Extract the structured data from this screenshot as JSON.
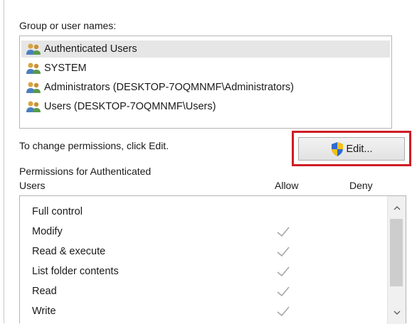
{
  "group_section": {
    "label": "Group or user names:",
    "users": [
      {
        "name": "Authenticated Users",
        "selected": true
      },
      {
        "name": "SYSTEM",
        "selected": false
      },
      {
        "name": "Administrators (DESKTOP-7OQMNMF\\Administrators)",
        "selected": false
      },
      {
        "name": "Users (DESKTOP-7OQMNMF\\Users)",
        "selected": false
      }
    ]
  },
  "change_hint": "To change permissions, click Edit.",
  "edit_button": {
    "label": "Edit...",
    "icon": "uac-shield-icon"
  },
  "permissions_section": {
    "label_line1": "Permissions for Authenticated",
    "label_line2": "Users",
    "allow_header": "Allow",
    "deny_header": "Deny",
    "rows": [
      {
        "name": "Full control",
        "allow": false,
        "deny": false
      },
      {
        "name": "Modify",
        "allow": true,
        "deny": false
      },
      {
        "name": "Read & execute",
        "allow": true,
        "deny": false
      },
      {
        "name": "List folder contents",
        "allow": true,
        "deny": false
      },
      {
        "name": "Read",
        "allow": true,
        "deny": false
      },
      {
        "name": "Write",
        "allow": true,
        "deny": false
      }
    ]
  },
  "colors": {
    "highlight_border": "#cf1c24",
    "selected_row": "#e6e6e6",
    "check_mark": "#a8a8a8"
  }
}
